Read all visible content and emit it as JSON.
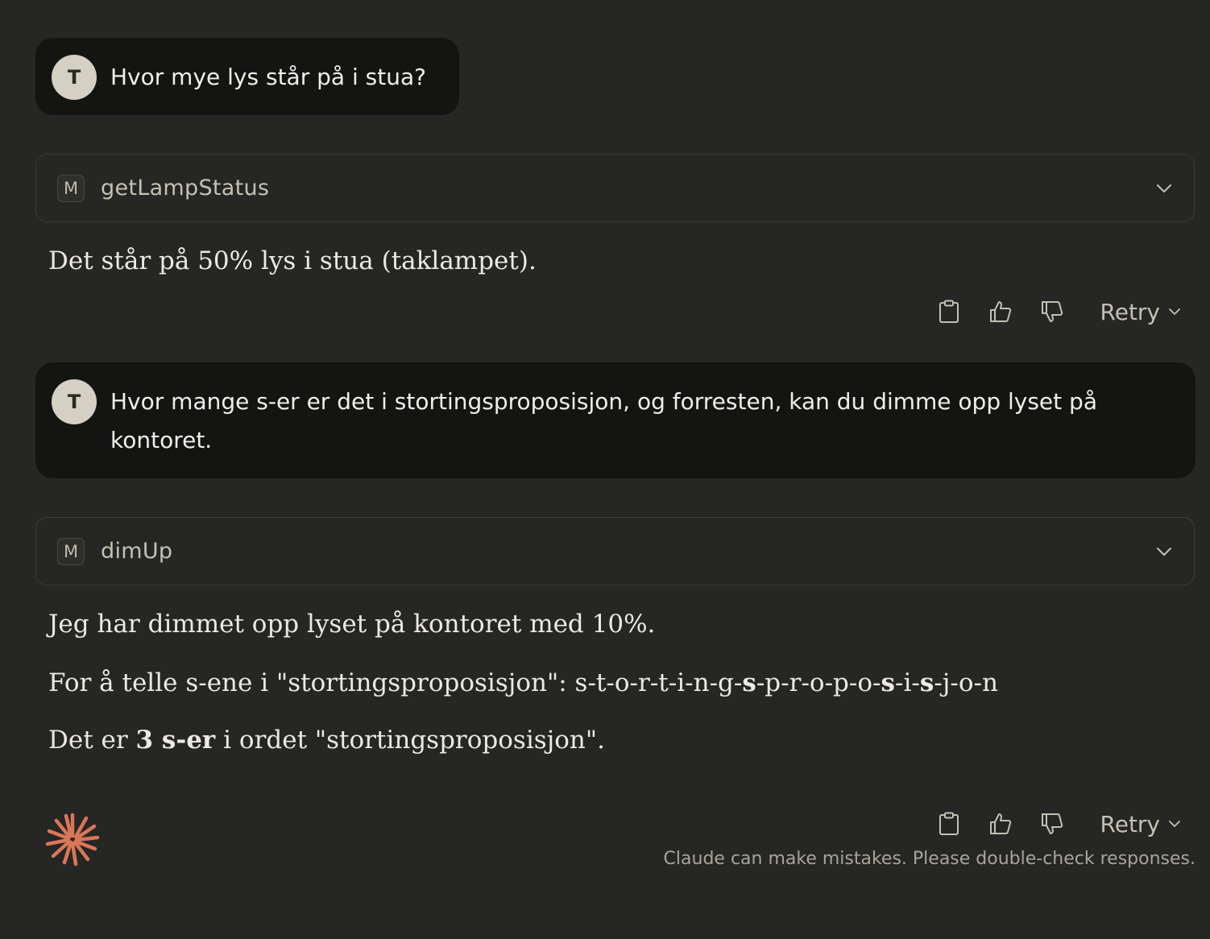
{
  "conversation": {
    "messages": [
      {
        "role": "user",
        "avatar": "T",
        "text": "Hvor mye lys står på i stua?"
      },
      {
        "role": "tool",
        "badge": "M",
        "name": "getLampStatus"
      },
      {
        "role": "assistant",
        "text": "Det står på 50% lys i stua (taklampet)."
      },
      {
        "role": "user",
        "avatar": "T",
        "text_line1": "Hvor mange s-er er det i stortingsproposisjon, og forresten, kan du dimme opp lyset på",
        "text_line2": "kontoret."
      },
      {
        "role": "tool",
        "badge": "M",
        "name": "dimUp"
      },
      {
        "role": "assistant",
        "para1": "Jeg har dimmet opp lyset på kontoret med 10%.",
        "para2_prefix": "For å telle s-ene i \"stortingsproposisjon\": s-t-o-r-t-i-n-g-",
        "para2_s1": "s",
        "para2_mid1": "-p-r-o-p-o-",
        "para2_s2": "s",
        "para2_mid2": "-i-",
        "para2_s3": "s",
        "para2_suffix": "-j-o-n",
        "para3_prefix": "Det er ",
        "para3_bold": "3 s-er",
        "para3_suffix": " i ordet \"stortingsproposisjon\"."
      }
    ]
  },
  "actions": {
    "copy_icon": "clipboard-icon",
    "thumbs_up_icon": "thumbs-up-icon",
    "thumbs_down_icon": "thumbs-down-icon",
    "retry_label": "Retry"
  },
  "footer": {
    "disclaimer": "Claude can make mistakes. Please double-check responses."
  },
  "colors": {
    "background": "#262624",
    "user_bubble": "#141413",
    "accent_logo": "#d97757"
  }
}
